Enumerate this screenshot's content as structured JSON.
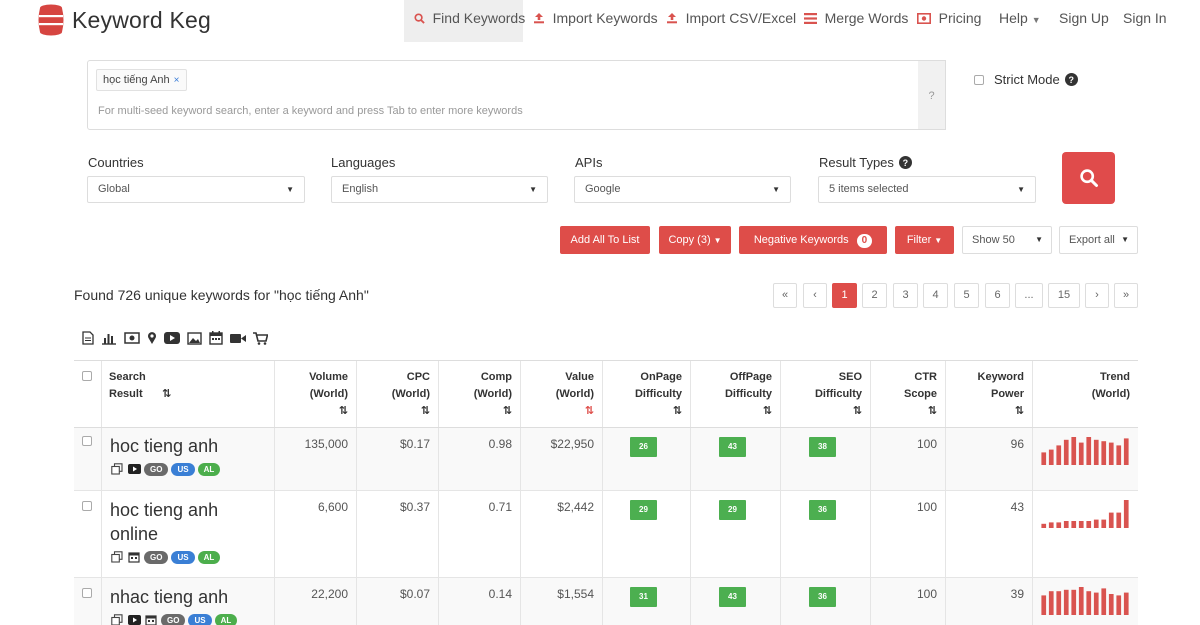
{
  "nav": {
    "brand": "Keyword Keg",
    "items": [
      {
        "label": "Find Keywords",
        "icon": "search-icon",
        "active": true
      },
      {
        "label": "Import Keywords",
        "icon": "upload-icon"
      },
      {
        "label": "Import CSV/Excel",
        "icon": "upload-icon"
      },
      {
        "label": "Merge Words",
        "icon": "list-icon"
      },
      {
        "label": "Pricing",
        "icon": "money-icon"
      },
      {
        "label": "Help",
        "icon": "caret-down-icon"
      },
      {
        "label": "Sign Up"
      },
      {
        "label": "Sign In"
      }
    ]
  },
  "search": {
    "seed_tag": "học tiếng Anh",
    "seed_remove": "×",
    "hint": "For multi-seed keyword search, enter a keyword and press Tab to enter more keywords",
    "help": "?",
    "strict_label": "Strict Mode",
    "strict_help": "?"
  },
  "filters": {
    "countries": {
      "label": "Countries",
      "value": "Global"
    },
    "languages": {
      "label": "Languages",
      "value": "English"
    },
    "apis": {
      "label": "APIs",
      "value": "Google"
    },
    "result_types": {
      "label": "Result Types",
      "value": "5 items selected",
      "help": "?"
    }
  },
  "actions": {
    "add_all": "Add All To List",
    "copy": "Copy (3)",
    "negative": "Negative Keywords",
    "negative_count": "0",
    "filter": "Filter",
    "show": "Show 50",
    "export": "Export all"
  },
  "found_text": "Found 726 unique keywords for \"học tiếng Anh\"",
  "pagination": [
    "«",
    "‹",
    "1",
    "2",
    "3",
    "4",
    "5",
    "6",
    "...",
    "15",
    "›",
    "»"
  ],
  "pagination_active": "1",
  "columns": {
    "search_result": "Search Result",
    "volume": "Volume (World)",
    "cpc": "CPC (World)",
    "comp": "Comp (World)",
    "value": "Value (World)",
    "onpage": "OnPage Difficulty",
    "offpage": "OffPage Difficulty",
    "seo": "SEO Difficulty",
    "ctr": "CTR Scope",
    "power": "Keyword Power",
    "trend": "Trend (World)"
  },
  "badge_labels": {
    "go": "GO",
    "us": "US",
    "al": "AL"
  },
  "rows": [
    {
      "keyword": "hoc tieng anh",
      "volume": "135,000",
      "cpc": "$0.17",
      "comp": "0.98",
      "value": "$22,950",
      "onpage": "26",
      "offpage": "43",
      "seo": "38",
      "ctr": "100",
      "power": "96",
      "trend": [
        0.45,
        0.55,
        0.7,
        0.9,
        1.0,
        0.8,
        1.0,
        0.9,
        0.85,
        0.8,
        0.7,
        0.95
      ]
    },
    {
      "keyword": "hoc tieng anh online",
      "volume": "6,600",
      "cpc": "$0.37",
      "comp": "0.71",
      "value": "$2,442",
      "onpage": "29",
      "offpage": "29",
      "seo": "36",
      "ctr": "100",
      "power": "43",
      "trend": [
        0.15,
        0.2,
        0.2,
        0.25,
        0.25,
        0.25,
        0.25,
        0.3,
        0.3,
        0.55,
        0.55,
        1.0
      ]
    },
    {
      "keyword": "nhac tieng anh",
      "volume": "22,200",
      "cpc": "$0.07",
      "comp": "0.14",
      "value": "$1,554",
      "onpage": "31",
      "offpage": "43",
      "seo": "36",
      "ctr": "100",
      "power": "39",
      "trend": [
        0.7,
        0.85,
        0.85,
        0.9,
        0.9,
        1.0,
        0.85,
        0.8,
        0.95,
        0.75,
        0.7,
        0.8
      ]
    }
  ]
}
